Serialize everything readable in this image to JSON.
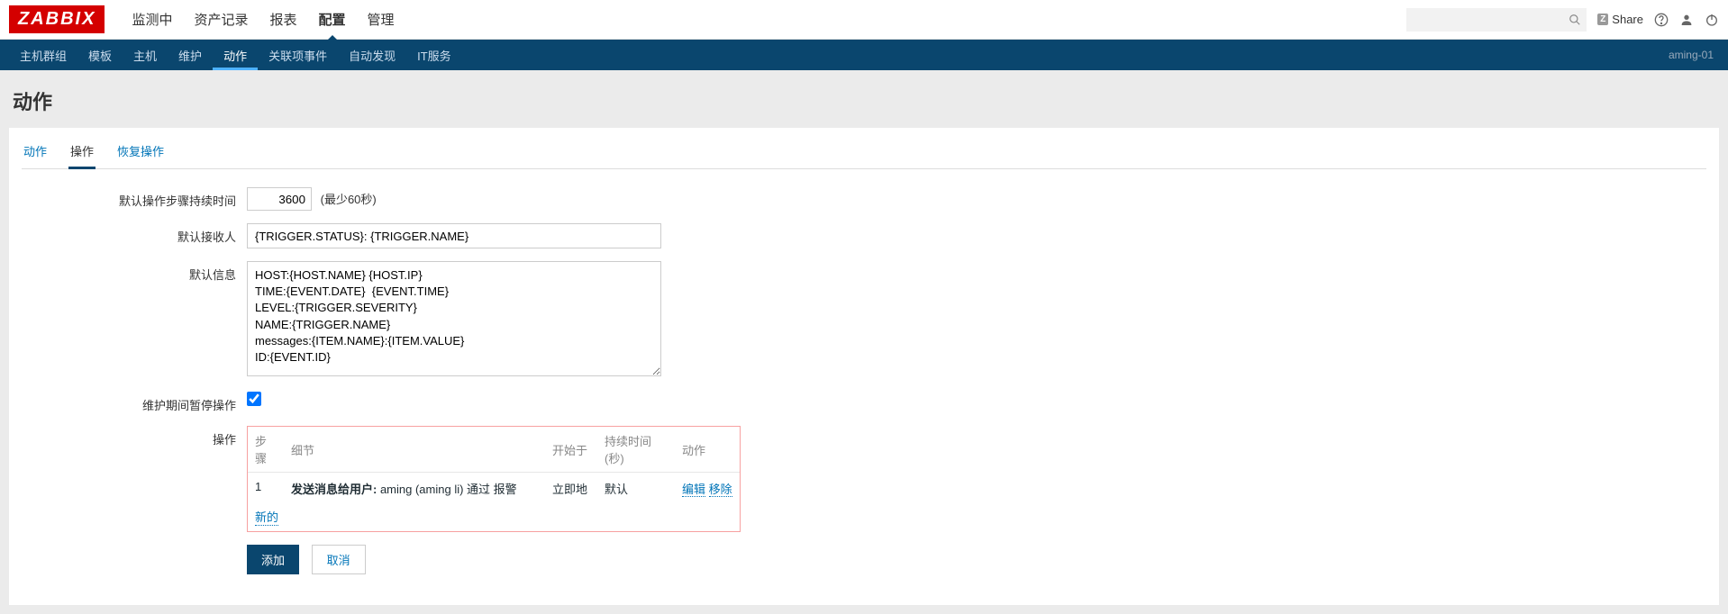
{
  "brand": "ZABBIX",
  "topnav": {
    "items": [
      "监测中",
      "资产记录",
      "报表",
      "配置",
      "管理"
    ],
    "active_index": 3
  },
  "topright": {
    "search_placeholder": "",
    "share_label": "Share"
  },
  "subnav": {
    "items": [
      "主机群组",
      "模板",
      "主机",
      "维护",
      "动作",
      "关联项事件",
      "自动发现",
      "IT服务"
    ],
    "active_index": 4,
    "right_text": "aming-01"
  },
  "page_title": "动作",
  "tabs": {
    "items": [
      "动作",
      "操作",
      "恢复操作"
    ],
    "active_index": 1
  },
  "form": {
    "step_duration_label": "默认操作步骤持续时间",
    "step_duration_value": "3600",
    "step_duration_hint": "(最少60秒)",
    "recipient_label": "默认接收人",
    "recipient_value": "{TRIGGER.STATUS}: {TRIGGER.NAME}",
    "message_label": "默认信息",
    "message_value": "HOST:{HOST.NAME} {HOST.IP}\nTIME:{EVENT.DATE}  {EVENT.TIME}\nLEVEL:{TRIGGER.SEVERITY}\nNAME:{TRIGGER.NAME}\nmessages:{ITEM.NAME}:{ITEM.VALUE}\nID:{EVENT.ID}",
    "pause_label": "维护期间暂停操作",
    "pause_checked": true,
    "ops_label": "操作"
  },
  "op_table": {
    "headers": [
      "步骤",
      "细节",
      "开始于",
      "持续时间(秒)",
      "动作"
    ],
    "rows": [
      {
        "step": "1",
        "detail_bold": "发送消息给用户:",
        "detail_rest": " aming (aming li) 通过 报警",
        "start": "立即地",
        "duration": "默认",
        "edit": "编辑",
        "remove": "移除"
      }
    ],
    "new_label": "新的"
  },
  "buttons": {
    "primary": "添加",
    "secondary": "取消"
  }
}
